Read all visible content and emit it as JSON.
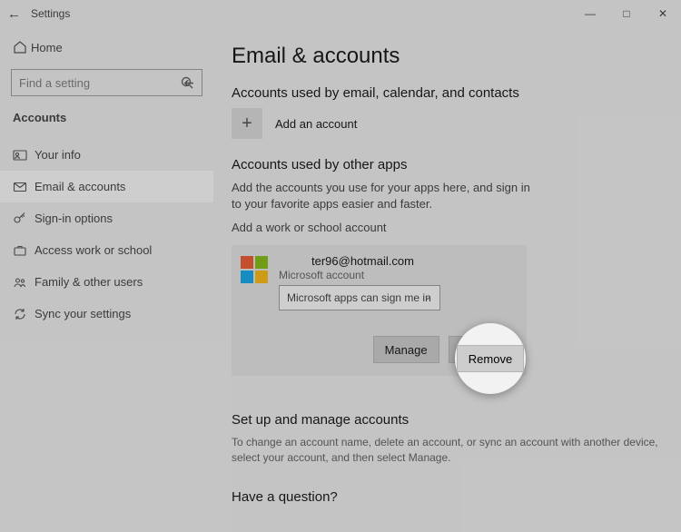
{
  "titlebar": {
    "title": "Settings"
  },
  "sidebar": {
    "home": "Home",
    "search_placeholder": "Find a setting",
    "group": "Accounts",
    "items": [
      {
        "label": "Your info"
      },
      {
        "label": "Email & accounts"
      },
      {
        "label": "Sign-in options"
      },
      {
        "label": "Access work or school"
      },
      {
        "label": "Family & other users"
      },
      {
        "label": "Sync your settings"
      }
    ]
  },
  "content": {
    "heading": "Email & accounts",
    "section1": {
      "title": "Accounts used by email, calendar, and contacts",
      "add_label": "Add an account"
    },
    "section2": {
      "title": "Accounts used by other apps",
      "desc": "Add the accounts you use for your apps here, and sign in to your favorite apps easier and faster.",
      "add_link": "Add a work or school account",
      "account": {
        "email": "ter96@hotmail.com",
        "type": "Microsoft account",
        "signin_option": "Microsoft apps can sign me in"
      },
      "manage_label": "Manage",
      "remove_label": "Remove"
    },
    "section3": {
      "title": "Set up and manage accounts",
      "desc": "To change an account name, delete an account, or sync an account with another device, select your account, and then select Manage."
    },
    "section4": {
      "title": "Have a question?"
    }
  }
}
